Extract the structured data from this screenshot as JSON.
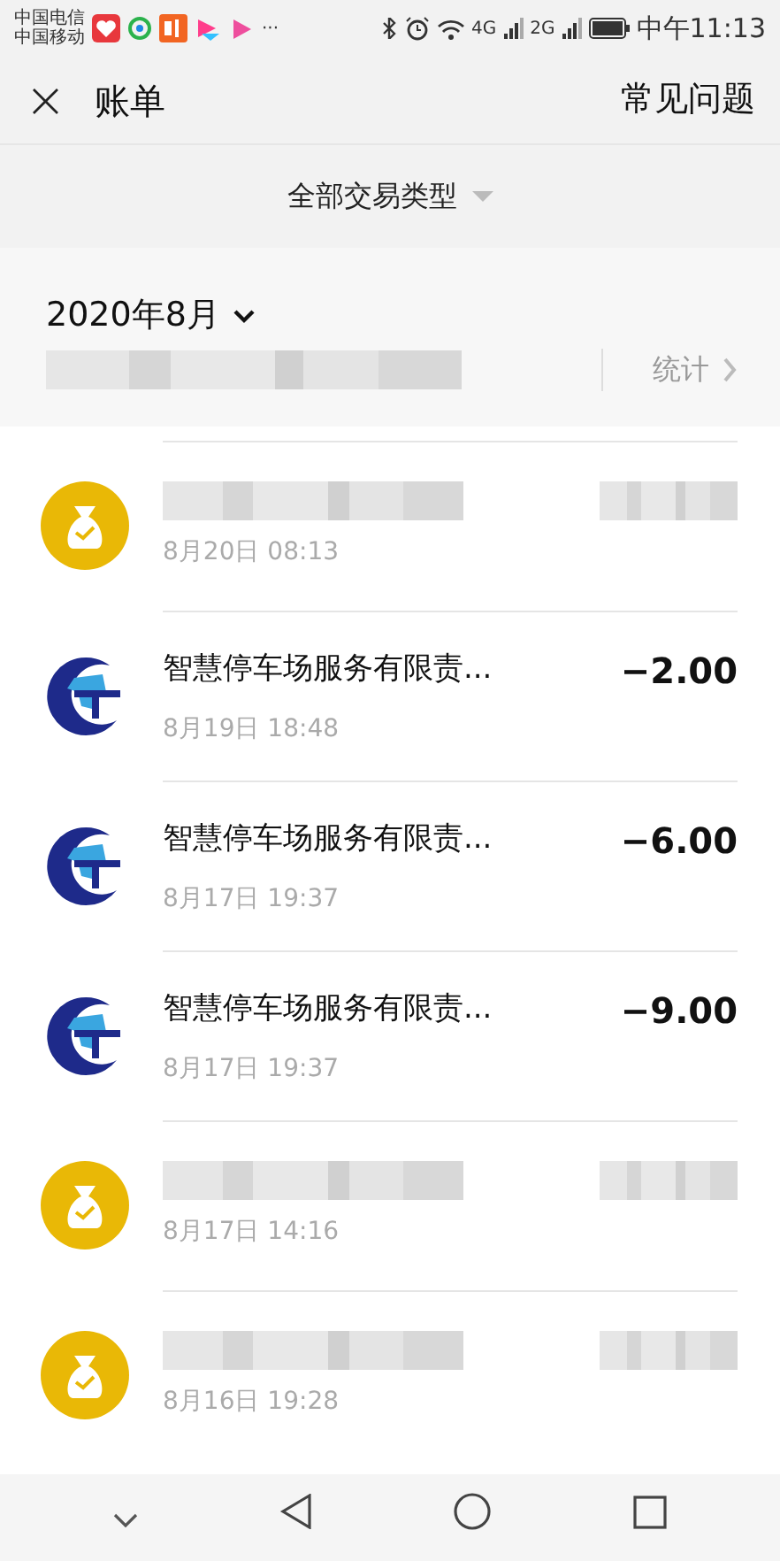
{
  "status_bar": {
    "carriers": [
      "中国电信",
      "中国移动"
    ],
    "more": "···",
    "network_labels": [
      "4G",
      "2G"
    ],
    "time": "中午11:13"
  },
  "header": {
    "close": "×",
    "title": "账单",
    "help": "常见问题"
  },
  "filter": {
    "label": "全部交易类型"
  },
  "month": {
    "label": "2020年8月",
    "stats": "统计"
  },
  "transactions": [
    {
      "kind": "redacted",
      "time": "8月20日 08:13"
    },
    {
      "kind": "merchant",
      "name": "智慧停车场服务有限责...",
      "amount": "−2.00",
      "time": "8月19日 18:48"
    },
    {
      "kind": "merchant",
      "name": "智慧停车场服务有限责...",
      "amount": "−6.00",
      "time": "8月17日 19:37"
    },
    {
      "kind": "merchant",
      "name": "智慧停车场服务有限责...",
      "amount": "−9.00",
      "time": "8月17日 19:37"
    },
    {
      "kind": "redacted",
      "time": "8月17日 14:16"
    },
    {
      "kind": "redacted",
      "time": "8月16日 19:28"
    }
  ]
}
